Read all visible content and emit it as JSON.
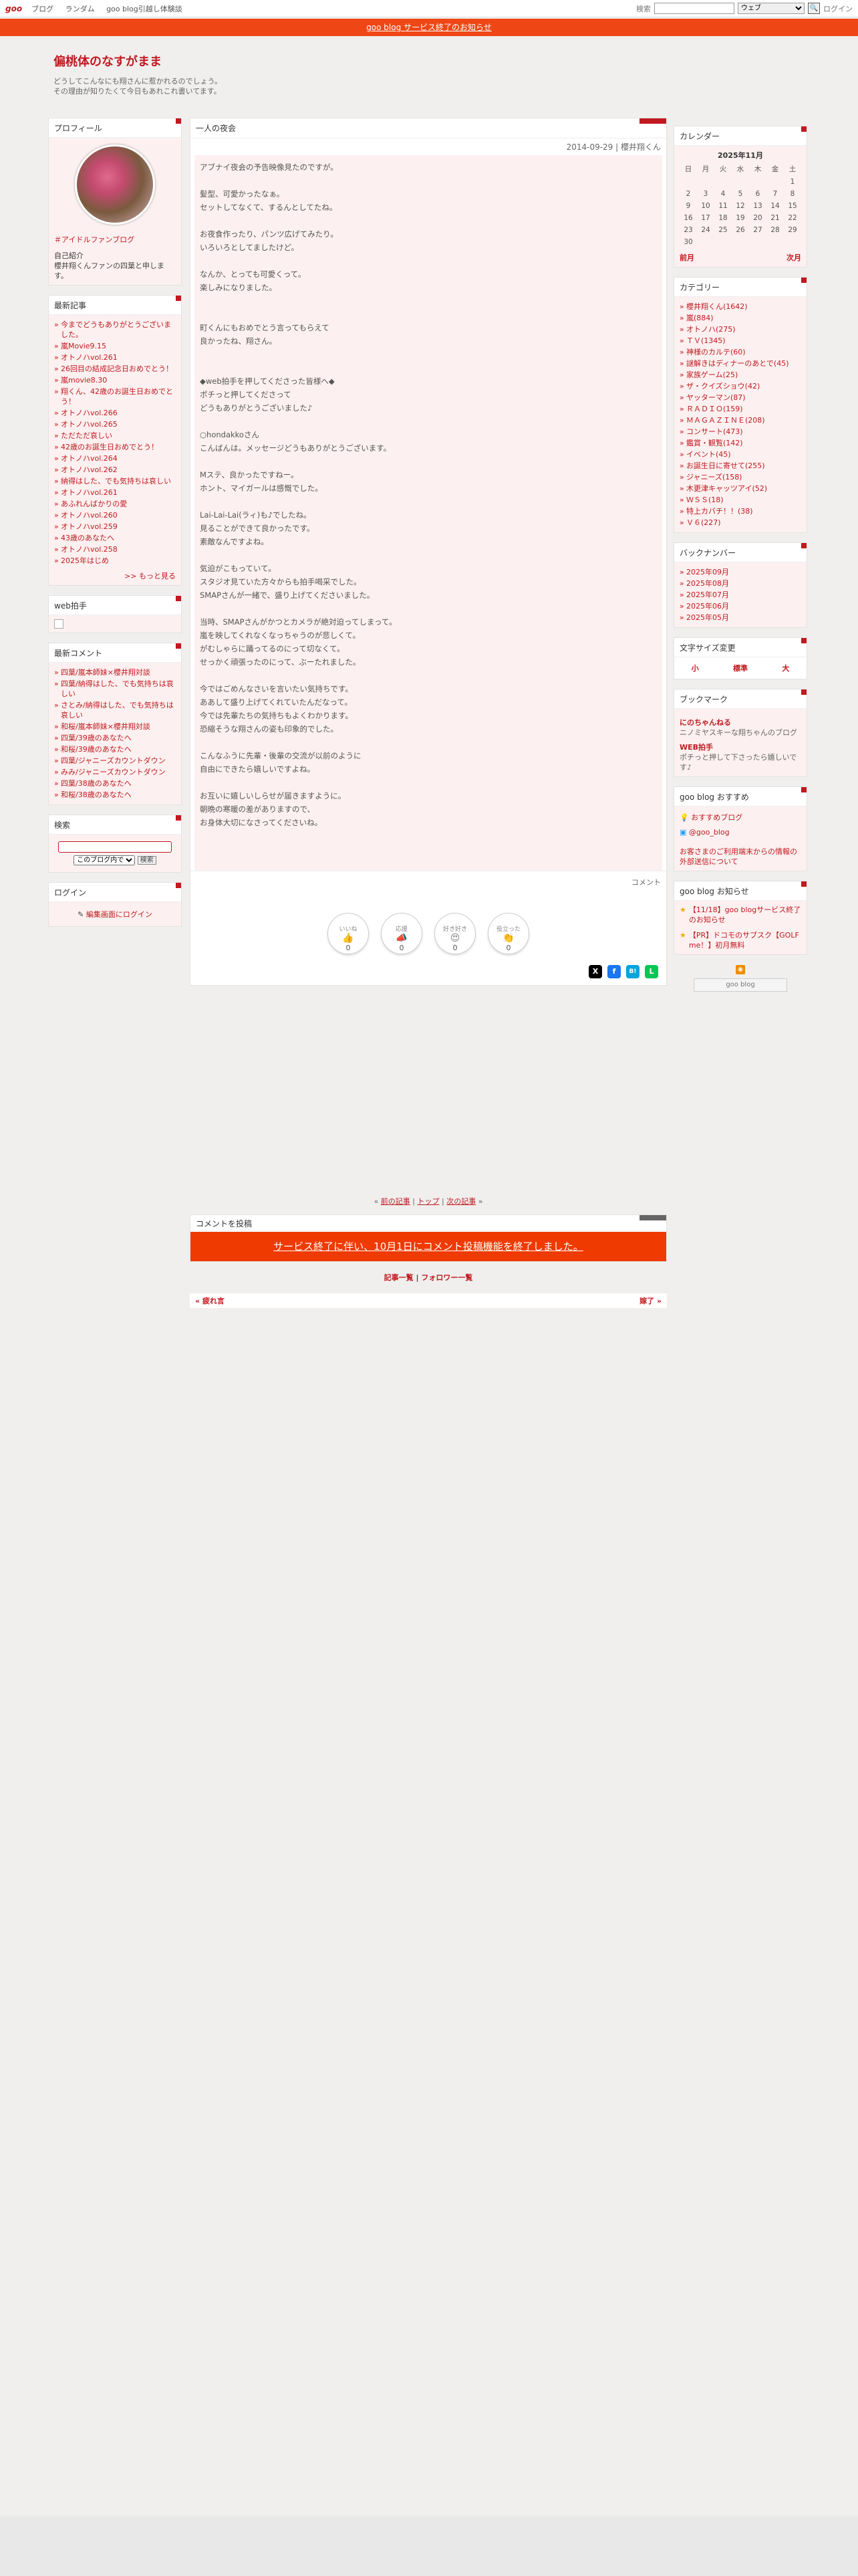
{
  "topbar": {
    "logo": "goo",
    "nav": [
      "ブログ",
      "ランダム",
      "goo blog引越し体験談"
    ],
    "search_label": "検索",
    "search_select": "ウェブ",
    "search_button": "🔍",
    "login": "ログイン"
  },
  "banner": "goo blog サービス終了のお知らせ",
  "blog": {
    "title": "偏桃体のなすがまま",
    "desc1": "どうしてこんなにも翔さんに惹かれるのでしょう。",
    "desc2": "その理由が知りたくて今日もあれこれ書いてます。"
  },
  "profile": {
    "heading": "プロフィール",
    "tag": "＃アイドルファンブログ",
    "intro_label": "自己紹介",
    "intro_text": "櫻井翔くんファンの四葉と申します。"
  },
  "recent": {
    "heading": "最新記事",
    "items": [
      "今までどうもありがとうございました。",
      "嵐Movie9.15",
      "オトノハvol.261",
      "26回目の結成記念日おめでとう！",
      "嵐movie8.30",
      "翔くん、42歳のお誕生日おめでとう！",
      "オトノハvol.266",
      "オトノハvol.265",
      "ただただ哀しい",
      "42歳のお誕生日おめでとう！",
      "オトノハvol.264",
      "オトノハvol.262",
      "納得はした、でも気持ちは哀しい",
      "オトノハvol.261",
      "あふれんばかりの愛",
      "オトノハvol.260",
      "オトノハvol.259",
      "43歳のあなたへ",
      "オトノハvol.258",
      "2025年はじめ"
    ],
    "more": ">> もっと見る"
  },
  "webclap": {
    "heading": "web拍手"
  },
  "comments": {
    "heading": "最新コメント",
    "items": [
      "四葉/嵐本師妹×櫻井翔対談",
      "四葉/納得はした、でも気持ちは哀しい",
      "さとみ/納得はした、でも気持ちは哀しい",
      "和桜/嵐本師妹×櫻井翔対談",
      "四葉/39歳のあなたへ",
      "和桜/39歳のあなたへ",
      "四葉/ジャニーズカウントダウン",
      "みみ/ジャニーズカウントダウン",
      "四葉/38歳のあなたへ",
      "和桜/38歳のあなたへ"
    ]
  },
  "search": {
    "heading": "検索",
    "select": "このブログ内で",
    "button": "検索"
  },
  "login": {
    "heading": "ログイン",
    "link": "編集画面にログイン"
  },
  "post": {
    "title": "一人の夜会",
    "date": "2014-09-29 | 櫻井翔くん",
    "body": "アブナイ夜会の予告映像見たのですが。\n\n髪型、可愛かったなぁ。\nセットしてなくて、するんとしてたね。\n\nお夜食作ったり、パンツ広げてみたり。\nいろいろとしてましたけど。\n\nなんか、とっても可愛くって。\n楽しみになりました。\n\n\n町くんにもおめでとう言ってもらえて\n良かったね、翔さん。\n\n\n◆web拍手を押してくださった皆様へ◆\nポチっと押してくださって\nどうもありがとうございました♪\n\n○hondakkoさん\nこんばんは。メッセージどうもありがとうございます。\n\nMステ、良かったですねー。\nホント、マイガールは感慨でした。\n\nLai-Lai-Lai(ラィ)も♪でしたね。\n見ることができて良かったです。\n素敵なんですよね。\n\n気迫がこもっていて。\nスタジオ見ていた方々からも拍手喝采でした。\nSMAPさんが一緒で、盛り上げてくださいました。\n\n当時、SMAPさんがかつとカメラが絶対迫ってしまって。\n嵐を映してくれなくなっちゃうのが悲しくて。\nがむしゃらに踊ってるのにって切なくて。\nせっかく頑張ったのにって、ぶーたれました。\n\n今ではごめんなさいを言いたい気持ちです。\nああして盛り上げてくれていたんだなって。\n今では先輩たちの気持ちもよくわかります。\n恐縮そうな翔さんの姿も印象的でした。\n\nこんなふうに先輩・後輩の交流が以前のように\n自由にできたら嬉しいですよね。\n\nお互いに嬉しいしらせが届きますように。\n朝晩の寒暖の差がありますので、\nお身体大切になさってくださいね。",
    "comment_link": "コメント",
    "reactions": [
      {
        "label": "いいね",
        "icon": "👍",
        "count": "0"
      },
      {
        "label": "応援",
        "icon": "📣",
        "count": "0"
      },
      {
        "label": "好き好き",
        "icon": "😍",
        "count": "0"
      },
      {
        "label": "役立った",
        "icon": "👏",
        "count": "0"
      }
    ],
    "share": [
      "X",
      "f",
      "B!",
      "L"
    ]
  },
  "pager": {
    "prev": "前の記事",
    "top": "トップ",
    "next": "次の記事"
  },
  "commentform": {
    "heading": "コメントを投稿",
    "notice": "サービス終了に伴い、10月1日にコメント投稿機能を終了しました。"
  },
  "links2": {
    "list": "記事一覧",
    "sep": " | ",
    "follow": "フォロワー一覧"
  },
  "nav_bottom": {
    "prev": "« 疲れ言",
    "next": "嫁了 »"
  },
  "calendar": {
    "heading": "カレンダー",
    "caption": "2025年11月",
    "days": [
      "日",
      "月",
      "火",
      "水",
      "木",
      "金",
      "土"
    ],
    "weeks": [
      [
        "",
        "",
        "",
        "",
        "",
        "",
        "1"
      ],
      [
        "2",
        "3",
        "4",
        "5",
        "6",
        "7",
        "8"
      ],
      [
        "9",
        "10",
        "11",
        "12",
        "13",
        "14",
        "15"
      ],
      [
        "16",
        "17",
        "18",
        "19",
        "20",
        "21",
        "22"
      ],
      [
        "23",
        "24",
        "25",
        "26",
        "27",
        "28",
        "29"
      ],
      [
        "30",
        "",
        "",
        "",
        "",
        "",
        ""
      ]
    ],
    "prev": "前月",
    "next": "次月"
  },
  "category": {
    "heading": "カテゴリー",
    "items": [
      "櫻井翔くん(1642)",
      "嵐(884)",
      "オトノハ(275)",
      "ＴＶ(1345)",
      "神様のカルテ(60)",
      "謎解きはディナーのあとで(45)",
      "家族ゲーム(25)",
      "ザ・クイズショウ(42)",
      "ヤッターマン(87)",
      "ＲＡＤＩＯ(159)",
      "ＭＡＧＡＺＩＮＥ(208)",
      "コンサート(473)",
      "鑑賞・観覧(142)",
      "イベント(45)",
      "お誕生日に寄せて(255)",
      "ジャニーズ(158)",
      "木更津キャッツアイ(52)",
      "ＷＳＳ(18)",
      "特上カバチ！！(38)",
      "Ｖ６(227)"
    ]
  },
  "backnumber": {
    "heading": "バックナンバー",
    "items": [
      "2025年09月",
      "2025年08月",
      "2025年07月",
      "2025年06月",
      "2025年05月"
    ]
  },
  "fontsize": {
    "heading": "文字サイズ変更",
    "small": "小",
    "normal": "標準",
    "large": "大"
  },
  "bookmark": {
    "heading": "ブックマーク",
    "items": [
      {
        "title": "にのちゃんねる",
        "desc": "ニノミヤスキーな翔ちゃんのブログ"
      },
      {
        "title": "WEB拍手",
        "desc": "ポチっと押して下さったら嬉しいです♪"
      }
    ]
  },
  "recommend": {
    "heading": "goo blog おすすめ",
    "items": [
      "おすすめブログ",
      "@goo_blog"
    ],
    "link": "お客さまのご利用端末からの情報の外部送信について"
  },
  "notice": {
    "heading": "goo blog お知らせ",
    "items": [
      "【11/18】goo blogサービス終了のお知らせ",
      "【PR】ドコモのサブスク【GOLF me！】初月無料"
    ]
  },
  "footer_logo": "goo blog",
  "colors": {
    "accent": "#c0191f",
    "banner": "#ef4615"
  }
}
